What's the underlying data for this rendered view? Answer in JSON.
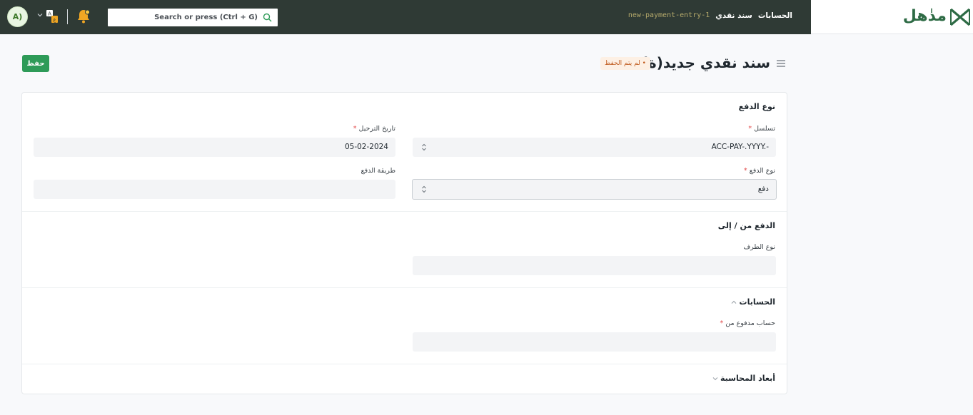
{
  "topbar": {
    "avatar_initials": "A)",
    "search_placeholder": "Search or press (Ctrl + G)",
    "breadcrumb": [
      "الحسابات",
      "سند نقدي"
    ],
    "breadcrumb_current": "new-payment-entry-1",
    "logo_text": "مدٰهل",
    "icons": [
      "search-icon",
      "bell-icon",
      "language-icon",
      "chevron-down-icon",
      "logo-mark"
    ],
    "accent_color": "#2f3a35"
  },
  "page": {
    "title": "سند نقدي جديد(ة)",
    "status_badge": "لم يتم الحفظ",
    "save_label": "حفظ",
    "save_color": "#2e9b58"
  },
  "form": {
    "section_payment_type": {
      "title": "نوع الدفع",
      "series_label": "تسلسل",
      "series_value": "ACC-PAY-.YYYY.-",
      "posting_date_label": "تاريخ الترحيل",
      "posting_date_value": "05-02-2024",
      "payment_type_label": "نوع الدفع",
      "payment_type_value": "دفع",
      "mode_of_payment_label": "طريقة الدفع",
      "mode_of_payment_value": ""
    },
    "section_party": {
      "title": "الدفع من / إلى",
      "party_type_label": "نوع الطرف",
      "party_type_value": ""
    },
    "section_accounts": {
      "title": "الحسابات",
      "paid_from_label": "حساب مدفوع من",
      "paid_from_value": ""
    },
    "section_dimensions": {
      "title": "أبعاد المحاسبة"
    }
  }
}
